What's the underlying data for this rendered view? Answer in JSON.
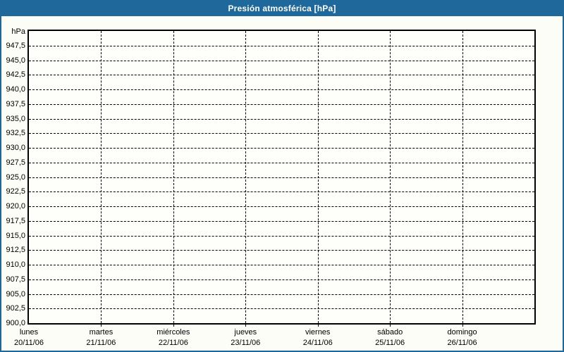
{
  "window": {
    "title": "Presión atmosférica [hPa]"
  },
  "colors": {
    "accent_blue": "#1f689c",
    "title_text": "#ffffff",
    "background": "#fcfdf7",
    "plot_background": "#fefefa",
    "grid": "#000000",
    "text": "#000000"
  },
  "chart_data": {
    "type": "line",
    "title": "Presión atmosférica [hPa]",
    "ylabel": "hPa",
    "xlabel": "",
    "ylim": [
      900,
      950
    ],
    "ytick_step": 2.5,
    "grid": "on",
    "legend": "none",
    "yticks": [
      {
        "value": 947.5,
        "label": "947,5"
      },
      {
        "value": 945.0,
        "label": "945,0"
      },
      {
        "value": 942.5,
        "label": "942,5"
      },
      {
        "value": 940.0,
        "label": "940,0"
      },
      {
        "value": 937.5,
        "label": "937,5"
      },
      {
        "value": 935.0,
        "label": "935,0"
      },
      {
        "value": 932.5,
        "label": "932,5"
      },
      {
        "value": 930.0,
        "label": "930,0"
      },
      {
        "value": 927.5,
        "label": "927,5"
      },
      {
        "value": 925.0,
        "label": "925,0"
      },
      {
        "value": 922.5,
        "label": "922,5"
      },
      {
        "value": 920.0,
        "label": "920,0"
      },
      {
        "value": 917.5,
        "label": "917,5"
      },
      {
        "value": 915.0,
        "label": "915,0"
      },
      {
        "value": 912.5,
        "label": "912,5"
      },
      {
        "value": 910.0,
        "label": "910,0"
      },
      {
        "value": 907.5,
        "label": "907,5"
      },
      {
        "value": 905.0,
        "label": "905,0"
      },
      {
        "value": 902.5,
        "label": "902,5"
      },
      {
        "value": 900.0,
        "label": "900,0"
      }
    ],
    "x_categories": [
      {
        "day": "lunes",
        "date": "20/11/06"
      },
      {
        "day": "martes",
        "date": "21/11/06"
      },
      {
        "day": "miércoles",
        "date": "22/11/06"
      },
      {
        "day": "jueves",
        "date": "23/11/06"
      },
      {
        "day": "viernes",
        "date": "24/11/06"
      },
      {
        "day": "sábado",
        "date": "25/11/06"
      },
      {
        "day": "domingo",
        "date": "26/11/06"
      }
    ],
    "series": []
  }
}
